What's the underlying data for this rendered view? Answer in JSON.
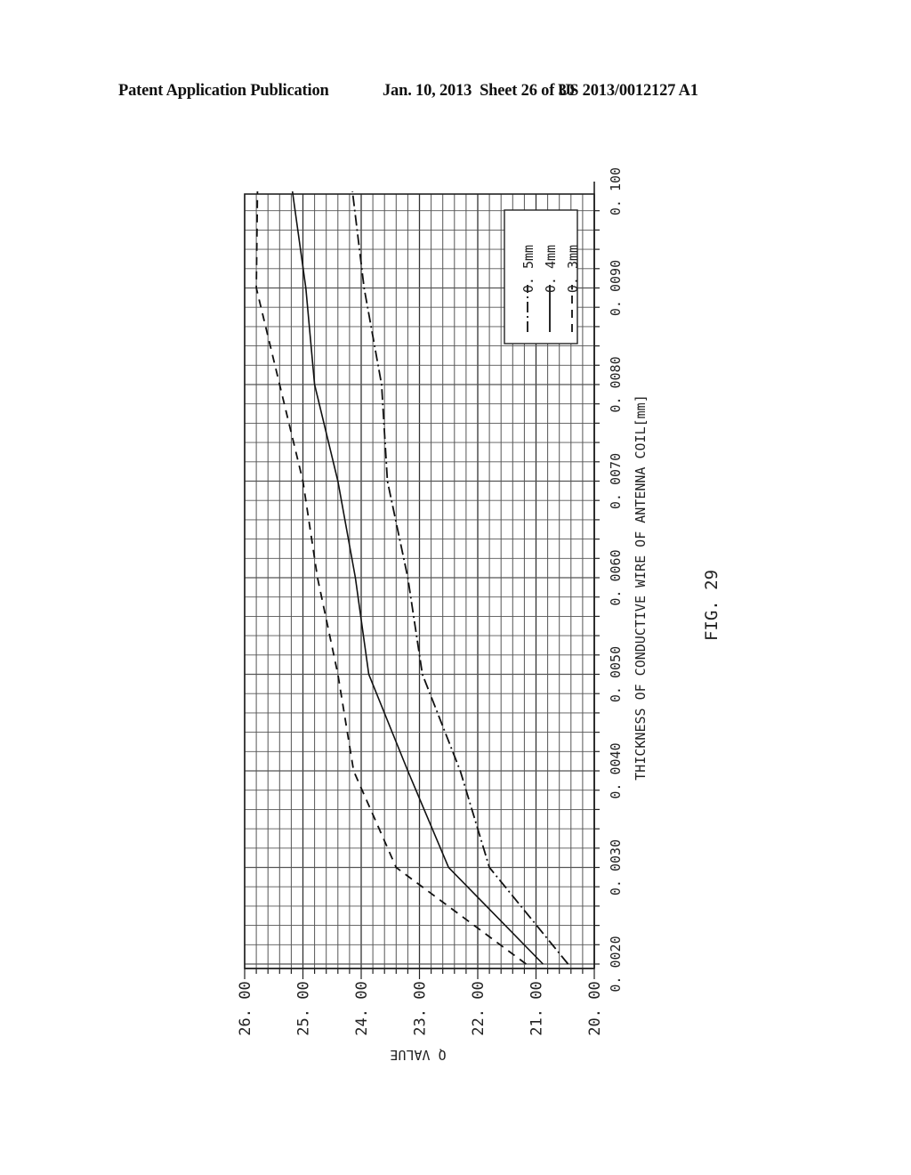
{
  "header": {
    "left": "Patent Application Publication",
    "date": "Jan. 10, 2013",
    "sheet": "Sheet 26 of 30",
    "number": "US 2013/0012127 A1"
  },
  "figure_label": "FIG. 29",
  "chart_data": {
    "type": "line",
    "orientation": "rotated-90-ccw",
    "title": "",
    "xlabel": "THICKNESS OF CONDUCTIVE WIRE OF ANTENNA COIL[mm]",
    "ylabel": "Q VALUE",
    "x": [
      0.002,
      0.003,
      0.004,
      0.005,
      0.006,
      0.007,
      0.008,
      0.009,
      0.01
    ],
    "x_tick_labels": [
      "0. 0020",
      "0. 0030",
      "0. 0040",
      "0. 0050",
      "0. 0060",
      "0. 0070",
      "0. 0080",
      "0. 0090",
      "0. 100"
    ],
    "y_tick_values": [
      20,
      21,
      22,
      23,
      24,
      25,
      26
    ],
    "y_tick_labels": [
      "20. 00",
      "21. 00",
      "22. 00",
      "23. 00",
      "24. 00",
      "25. 00",
      "26. 00"
    ],
    "xlim": [
      0.002,
      0.0102
    ],
    "ylim": [
      20,
      26
    ],
    "grid": true,
    "legend_position": "top-right",
    "series": [
      {
        "name": "0. 5mm",
        "style": "dash-dot",
        "values": [
          20.45,
          21.8,
          22.3,
          22.95,
          23.2,
          23.55,
          23.65,
          23.95,
          24.15
        ]
      },
      {
        "name": "0. 4mm",
        "style": "solid",
        "values": [
          20.88,
          22.5,
          23.2,
          23.87,
          24.1,
          24.4,
          24.8,
          24.95,
          25.18
        ]
      },
      {
        "name": "0. 3mm",
        "style": "dashed",
        "values": [
          21.17,
          23.4,
          24.13,
          24.4,
          24.75,
          25.0,
          25.4,
          25.8,
          25.78
        ]
      }
    ]
  }
}
